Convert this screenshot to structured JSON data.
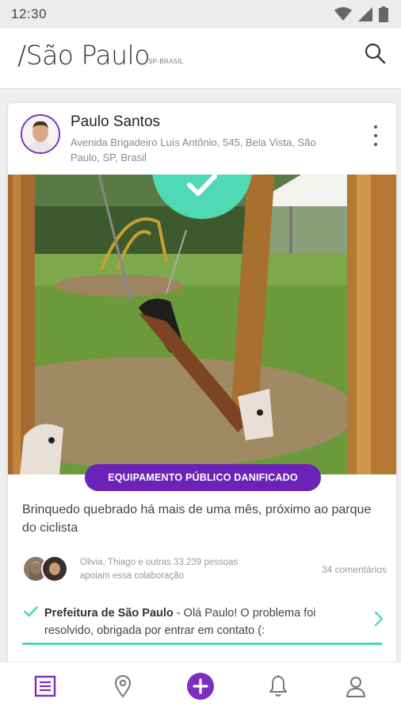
{
  "status_bar": {
    "time": "12:30",
    "icons": [
      "wifi-icon",
      "signal-icon",
      "battery-icon"
    ]
  },
  "header": {
    "title": "/São Paulo",
    "subtitle": "SP-BRASIL"
  },
  "post": {
    "user_name": "Paulo Santos",
    "address": "Avenida Brigadeiro Luís Antônio, 545, Bela Vista, São Paulo, SP, Brasil",
    "category": "EQUIPAMENTO PÚBLICO DANIFICADO",
    "description": "Brinquedo quebrado há mais de uma mês, próximo ao parque do ciclista",
    "supporters_text": "Olivia, Thiago e outras 33.239 pessoas apoiam essa colaboração",
    "comments": "34 comentários",
    "reply": {
      "author": "Prefeitura de São Paulo",
      "message": " - Olá Paulo! O problema foi resolvido, obrigada por entrar em contato (:"
    }
  },
  "nav": {
    "items": [
      "feed-icon",
      "location-pin-icon",
      "add-icon",
      "notifications-icon",
      "profile-icon"
    ],
    "active": "feed-icon"
  },
  "colors": {
    "accent": "#6b22b8",
    "success": "#4fd9b4",
    "status_bar": "#ececec"
  }
}
